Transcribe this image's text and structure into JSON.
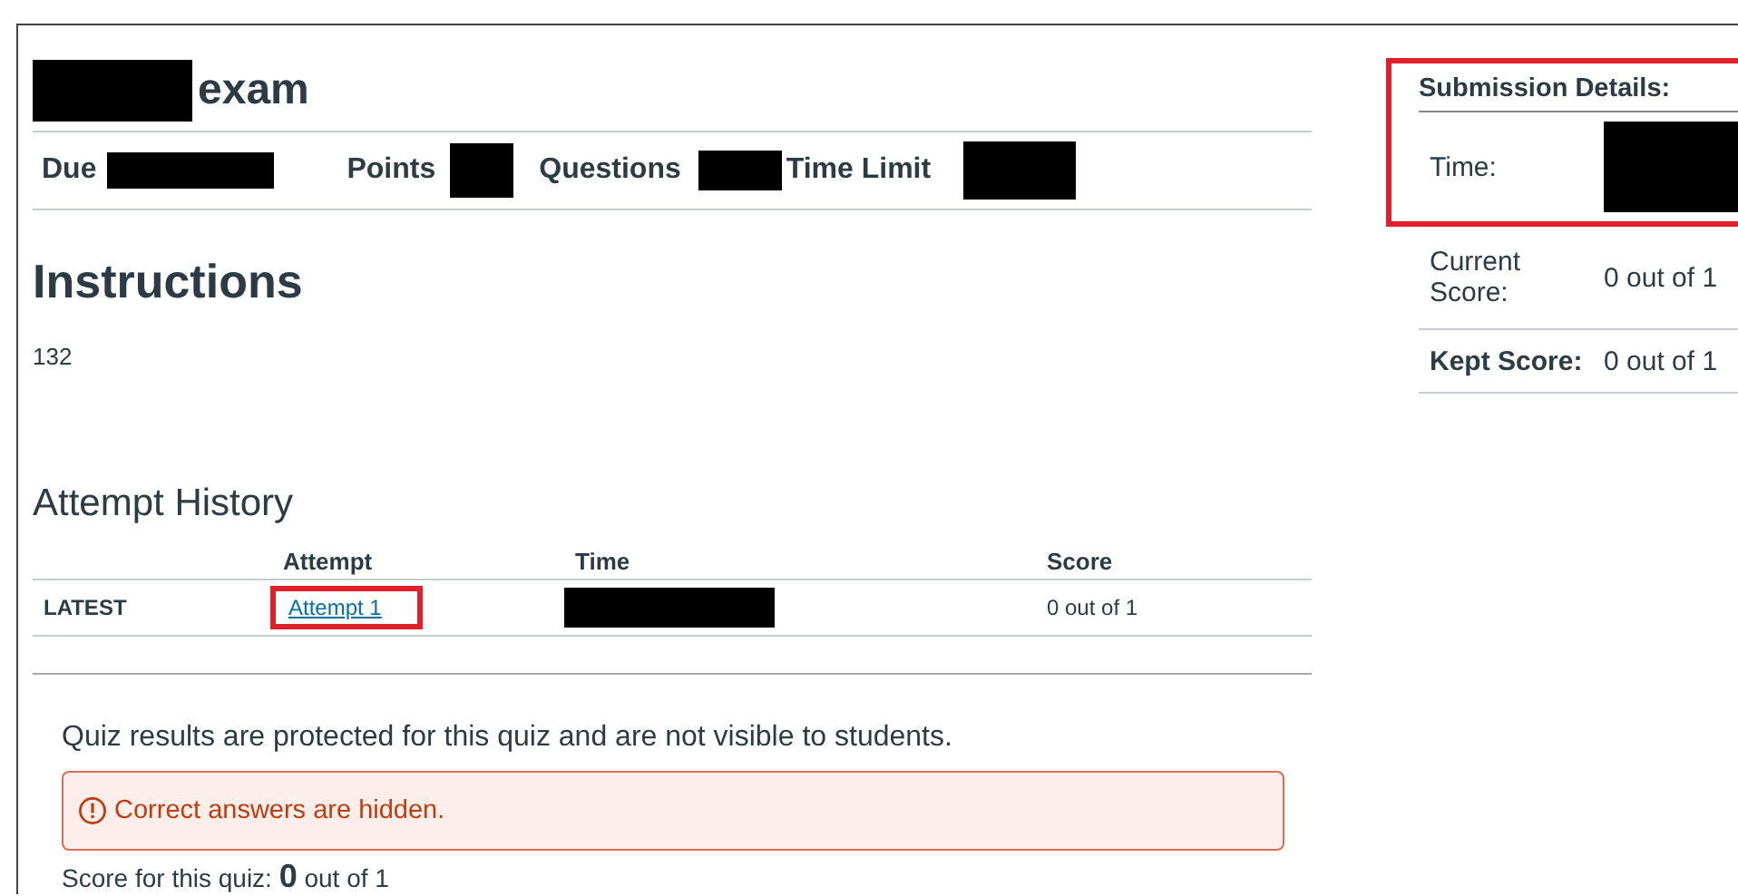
{
  "quiz": {
    "title": "exam",
    "title_redacted": true,
    "meta": [
      {
        "label": "Due",
        "redacted": true
      },
      {
        "label": "Points",
        "redacted": true
      },
      {
        "label": "Questions",
        "redacted": true
      },
      {
        "label": "Time Limit",
        "redacted": true
      }
    ],
    "instructions_heading": "Instructions",
    "instructions": "132"
  },
  "attempt_history": {
    "heading": "Attempt History",
    "columns": [
      "Attempt",
      "Time",
      "Score"
    ],
    "rows": [
      {
        "label": "LATEST",
        "attempt": "Attempt 1",
        "highlighted": true,
        "time_redacted": true,
        "score": "0 out of 1"
      }
    ]
  },
  "results": {
    "notice": "Quiz results are protected for this quiz and are not visible to students.",
    "alert": "Correct answers are hidden.",
    "score_line": "Score for this quiz: **0** out of 1"
  },
  "submission": {
    "heading": "Submission Details:",
    "highlighted": true,
    "rows": [
      {
        "label": "Time:",
        "redacted": true,
        "highlighted": true
      },
      {
        "label": "Current Score:",
        "value": "0 out of 1",
        "highlighted": false
      },
      {
        "label": "Kept Score:",
        "value": "0 out of 1",
        "highlighted": false
      }
    ]
  }
}
